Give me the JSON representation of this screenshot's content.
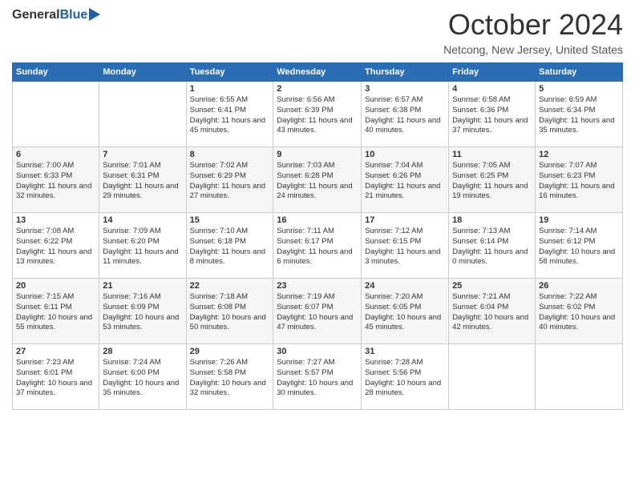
{
  "logo": {
    "general": "General",
    "blue": "Blue"
  },
  "header": {
    "month": "October 2024",
    "location": "Netcong, New Jersey, United States"
  },
  "days_of_week": [
    "Sunday",
    "Monday",
    "Tuesday",
    "Wednesday",
    "Thursday",
    "Friday",
    "Saturday"
  ],
  "weeks": [
    [
      {
        "day": "",
        "info": ""
      },
      {
        "day": "",
        "info": ""
      },
      {
        "day": "1",
        "info": "Sunrise: 6:55 AM\nSunset: 6:41 PM\nDaylight: 11 hours and 45 minutes."
      },
      {
        "day": "2",
        "info": "Sunrise: 6:56 AM\nSunset: 6:39 PM\nDaylight: 11 hours and 43 minutes."
      },
      {
        "day": "3",
        "info": "Sunrise: 6:57 AM\nSunset: 6:38 PM\nDaylight: 11 hours and 40 minutes."
      },
      {
        "day": "4",
        "info": "Sunrise: 6:58 AM\nSunset: 6:36 PM\nDaylight: 11 hours and 37 minutes."
      },
      {
        "day": "5",
        "info": "Sunrise: 6:59 AM\nSunset: 6:34 PM\nDaylight: 11 hours and 35 minutes."
      }
    ],
    [
      {
        "day": "6",
        "info": "Sunrise: 7:00 AM\nSunset: 6:33 PM\nDaylight: 11 hours and 32 minutes."
      },
      {
        "day": "7",
        "info": "Sunrise: 7:01 AM\nSunset: 6:31 PM\nDaylight: 11 hours and 29 minutes."
      },
      {
        "day": "8",
        "info": "Sunrise: 7:02 AM\nSunset: 6:29 PM\nDaylight: 11 hours and 27 minutes."
      },
      {
        "day": "9",
        "info": "Sunrise: 7:03 AM\nSunset: 6:28 PM\nDaylight: 11 hours and 24 minutes."
      },
      {
        "day": "10",
        "info": "Sunrise: 7:04 AM\nSunset: 6:26 PM\nDaylight: 11 hours and 21 minutes."
      },
      {
        "day": "11",
        "info": "Sunrise: 7:05 AM\nSunset: 6:25 PM\nDaylight: 11 hours and 19 minutes."
      },
      {
        "day": "12",
        "info": "Sunrise: 7:07 AM\nSunset: 6:23 PM\nDaylight: 11 hours and 16 minutes."
      }
    ],
    [
      {
        "day": "13",
        "info": "Sunrise: 7:08 AM\nSunset: 6:22 PM\nDaylight: 11 hours and 13 minutes."
      },
      {
        "day": "14",
        "info": "Sunrise: 7:09 AM\nSunset: 6:20 PM\nDaylight: 11 hours and 11 minutes."
      },
      {
        "day": "15",
        "info": "Sunrise: 7:10 AM\nSunset: 6:18 PM\nDaylight: 11 hours and 8 minutes."
      },
      {
        "day": "16",
        "info": "Sunrise: 7:11 AM\nSunset: 6:17 PM\nDaylight: 11 hours and 6 minutes."
      },
      {
        "day": "17",
        "info": "Sunrise: 7:12 AM\nSunset: 6:15 PM\nDaylight: 11 hours and 3 minutes."
      },
      {
        "day": "18",
        "info": "Sunrise: 7:13 AM\nSunset: 6:14 PM\nDaylight: 11 hours and 0 minutes."
      },
      {
        "day": "19",
        "info": "Sunrise: 7:14 AM\nSunset: 6:12 PM\nDaylight: 10 hours and 58 minutes."
      }
    ],
    [
      {
        "day": "20",
        "info": "Sunrise: 7:15 AM\nSunset: 6:11 PM\nDaylight: 10 hours and 55 minutes."
      },
      {
        "day": "21",
        "info": "Sunrise: 7:16 AM\nSunset: 6:09 PM\nDaylight: 10 hours and 53 minutes."
      },
      {
        "day": "22",
        "info": "Sunrise: 7:18 AM\nSunset: 6:08 PM\nDaylight: 10 hours and 50 minutes."
      },
      {
        "day": "23",
        "info": "Sunrise: 7:19 AM\nSunset: 6:07 PM\nDaylight: 10 hours and 47 minutes."
      },
      {
        "day": "24",
        "info": "Sunrise: 7:20 AM\nSunset: 6:05 PM\nDaylight: 10 hours and 45 minutes."
      },
      {
        "day": "25",
        "info": "Sunrise: 7:21 AM\nSunset: 6:04 PM\nDaylight: 10 hours and 42 minutes."
      },
      {
        "day": "26",
        "info": "Sunrise: 7:22 AM\nSunset: 6:02 PM\nDaylight: 10 hours and 40 minutes."
      }
    ],
    [
      {
        "day": "27",
        "info": "Sunrise: 7:23 AM\nSunset: 6:01 PM\nDaylight: 10 hours and 37 minutes."
      },
      {
        "day": "28",
        "info": "Sunrise: 7:24 AM\nSunset: 6:00 PM\nDaylight: 10 hours and 35 minutes."
      },
      {
        "day": "29",
        "info": "Sunrise: 7:26 AM\nSunset: 5:58 PM\nDaylight: 10 hours and 32 minutes."
      },
      {
        "day": "30",
        "info": "Sunrise: 7:27 AM\nSunset: 5:57 PM\nDaylight: 10 hours and 30 minutes."
      },
      {
        "day": "31",
        "info": "Sunrise: 7:28 AM\nSunset: 5:56 PM\nDaylight: 10 hours and 28 minutes."
      },
      {
        "day": "",
        "info": ""
      },
      {
        "day": "",
        "info": ""
      }
    ]
  ]
}
